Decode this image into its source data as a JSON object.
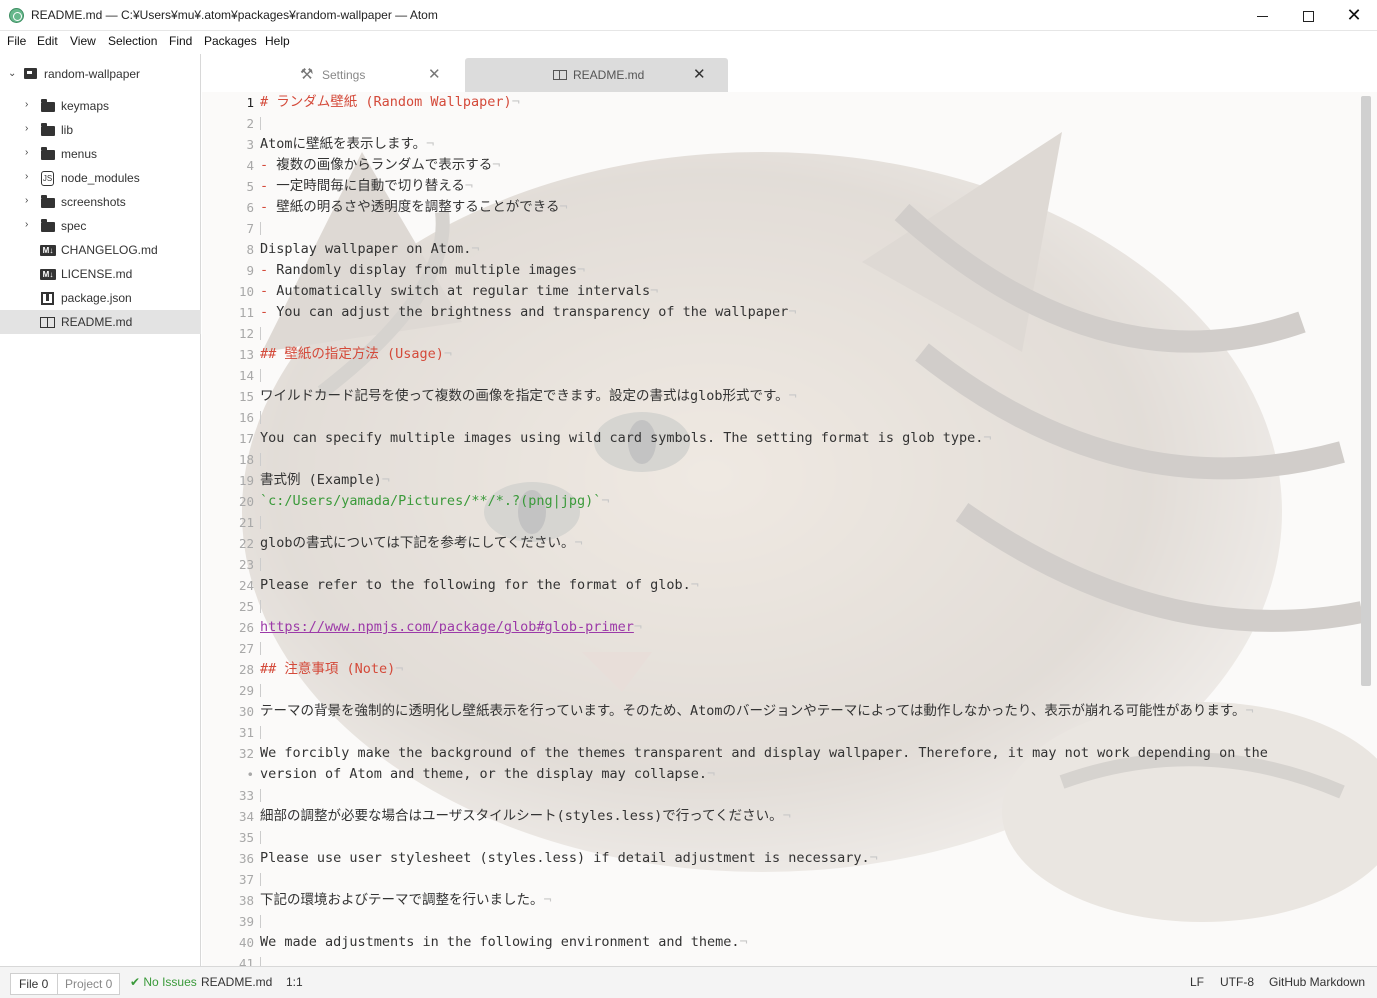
{
  "window": {
    "title": "README.md — C:¥Users¥mu¥.atom¥packages¥random-wallpaper — Atom",
    "minimize_icon": "minimize-icon",
    "maximize_icon": "maximize-icon",
    "close_icon": "close-icon",
    "close_glyph": "✕"
  },
  "menubar": {
    "items": [
      "File",
      "Edit",
      "View",
      "Selection",
      "Find",
      "Packages",
      "Help"
    ]
  },
  "tree": {
    "root": {
      "label": "random-wallpaper",
      "chevron": "⌄"
    },
    "items": [
      {
        "label": "keymaps",
        "icon": "folder-icon",
        "chevron": "›"
      },
      {
        "label": "lib",
        "icon": "folder-icon",
        "chevron": "›"
      },
      {
        "label": "menus",
        "icon": "folder-icon",
        "chevron": "›"
      },
      {
        "label": "node_modules",
        "icon": "node-modules-icon",
        "chevron": "›",
        "icon_glyph": "JS"
      },
      {
        "label": "screenshots",
        "icon": "folder-icon",
        "chevron": "›"
      },
      {
        "label": "spec",
        "icon": "folder-icon",
        "chevron": "›"
      },
      {
        "label": "CHANGELOG.md",
        "icon": "markdown-icon",
        "icon_glyph": "M↓"
      },
      {
        "label": "LICENSE.md",
        "icon": "markdown-icon",
        "icon_glyph": "M↓"
      },
      {
        "label": "package.json",
        "icon": "package-icon"
      },
      {
        "label": "README.md",
        "icon": "book-icon",
        "selected": true
      }
    ]
  },
  "tabs": {
    "settings": {
      "label": "Settings",
      "close": "✕",
      "icon_glyph": "⚒"
    },
    "readme": {
      "label": "README.md",
      "close": "✕"
    }
  },
  "editor": {
    "eol_mark": "¬",
    "lines": [
      {
        "num": "1",
        "segments": [
          {
            "t": "# ランダム壁紙 (Random Wallpaper)",
            "c": "heading"
          }
        ]
      },
      {
        "num": "2",
        "segments": []
      },
      {
        "num": "3",
        "segments": [
          {
            "t": "Atomに壁紙を表示します。",
            "c": ""
          }
        ]
      },
      {
        "num": "4",
        "segments": [
          {
            "t": "-",
            "c": "bullet"
          },
          {
            "t": " 複数の画像からランダムで表示する",
            "c": ""
          }
        ]
      },
      {
        "num": "5",
        "segments": [
          {
            "t": "-",
            "c": "bullet"
          },
          {
            "t": " 一定時間毎に自動で切り替える",
            "c": ""
          }
        ]
      },
      {
        "num": "6",
        "segments": [
          {
            "t": "-",
            "c": "bullet"
          },
          {
            "t": " 壁紙の明るさや透明度を調整することができる",
            "c": ""
          }
        ]
      },
      {
        "num": "7",
        "segments": []
      },
      {
        "num": "8",
        "segments": [
          {
            "t": "Display wallpaper on Atom.",
            "c": ""
          }
        ]
      },
      {
        "num": "9",
        "segments": [
          {
            "t": "-",
            "c": "bullet"
          },
          {
            "t": " Randomly display from multiple images",
            "c": ""
          }
        ]
      },
      {
        "num": "10",
        "segments": [
          {
            "t": "-",
            "c": "bullet"
          },
          {
            "t": " Automatically switch at regular time intervals",
            "c": ""
          }
        ]
      },
      {
        "num": "11",
        "segments": [
          {
            "t": "-",
            "c": "bullet"
          },
          {
            "t": " You can adjust the brightness and transparency of the wallpaper",
            "c": ""
          }
        ]
      },
      {
        "num": "12",
        "segments": []
      },
      {
        "num": "13",
        "segments": [
          {
            "t": "## 壁紙の指定方法 (Usage)",
            "c": "heading"
          }
        ]
      },
      {
        "num": "14",
        "segments": []
      },
      {
        "num": "15",
        "segments": [
          {
            "t": "ワイルドカード記号を使って複数の画像を指定できます。設定の書式はglob形式です。",
            "c": ""
          }
        ]
      },
      {
        "num": "16",
        "segments": []
      },
      {
        "num": "17",
        "segments": [
          {
            "t": "You can specify multiple images using wild card symbols. The setting format is glob type.",
            "c": ""
          }
        ]
      },
      {
        "num": "18",
        "segments": []
      },
      {
        "num": "19",
        "segments": [
          {
            "t": "書式例 (Example)",
            "c": ""
          }
        ]
      },
      {
        "num": "20",
        "segments": [
          {
            "t": "`c:/Users/yamada/Pictures/**/*.?(png|jpg)`",
            "c": "code-span"
          }
        ]
      },
      {
        "num": "21",
        "segments": []
      },
      {
        "num": "22",
        "segments": [
          {
            "t": "globの書式については下記を参考にしてください。",
            "c": ""
          }
        ]
      },
      {
        "num": "23",
        "segments": []
      },
      {
        "num": "24",
        "segments": [
          {
            "t": "Please refer to the following for the format of glob.",
            "c": ""
          }
        ]
      },
      {
        "num": "25",
        "segments": []
      },
      {
        "num": "26",
        "segments": [
          {
            "t": "https://www.npmjs.com/package/glob#glob-primer",
            "c": "link"
          }
        ]
      },
      {
        "num": "27",
        "segments": []
      },
      {
        "num": "28",
        "segments": [
          {
            "t": "## 注意事項 (Note)",
            "c": "heading"
          }
        ]
      },
      {
        "num": "29",
        "segments": []
      },
      {
        "num": "30",
        "segments": [
          {
            "t": "テーマの背景を強制的に透明化し壁紙表示を行っています。そのため、Atomのバージョンやテーマによっては動作しなかったり、表示が崩れる可能性があります。",
            "c": ""
          }
        ]
      },
      {
        "num": "31",
        "segments": []
      },
      {
        "num": "32",
        "segments": [
          {
            "t": "We forcibly make the background of the themes transparent and display wallpaper. Therefore, it may not work depending on the",
            "c": ""
          }
        ],
        "noeol": true
      },
      {
        "num": "•",
        "segments": [
          {
            "t": "version of Atom and theme, or the display may collapse.",
            "c": ""
          }
        ]
      },
      {
        "num": "33",
        "segments": []
      },
      {
        "num": "34",
        "segments": [
          {
            "t": "細部の調整が必要な場合はユーザスタイルシート(styles.less)で行ってください。",
            "c": ""
          }
        ]
      },
      {
        "num": "35",
        "segments": []
      },
      {
        "num": "36",
        "segments": [
          {
            "t": "Please use user stylesheet (styles.less) if detail adjustment is necessary.",
            "c": ""
          }
        ]
      },
      {
        "num": "37",
        "segments": []
      },
      {
        "num": "38",
        "segments": [
          {
            "t": "下記の環境およびテーマで調整を行いました。",
            "c": ""
          }
        ]
      },
      {
        "num": "39",
        "segments": []
      },
      {
        "num": "40",
        "segments": [
          {
            "t": "We made adjustments in the following environment and theme.",
            "c": ""
          }
        ]
      },
      {
        "num": "41",
        "segments": []
      }
    ]
  },
  "status": {
    "file_count": "File 0",
    "project_count": "Project 0",
    "linter": "✔ No Issues",
    "filename": "README.md",
    "cursor": "1:1",
    "line_ending": "LF",
    "encoding": "UTF-8",
    "grammar": "GitHub Markdown"
  },
  "colors": {
    "heading": "#d44a3a",
    "code": "#3a9a3a",
    "link": "#9c3aa8",
    "ok": "#3a9a3a"
  }
}
